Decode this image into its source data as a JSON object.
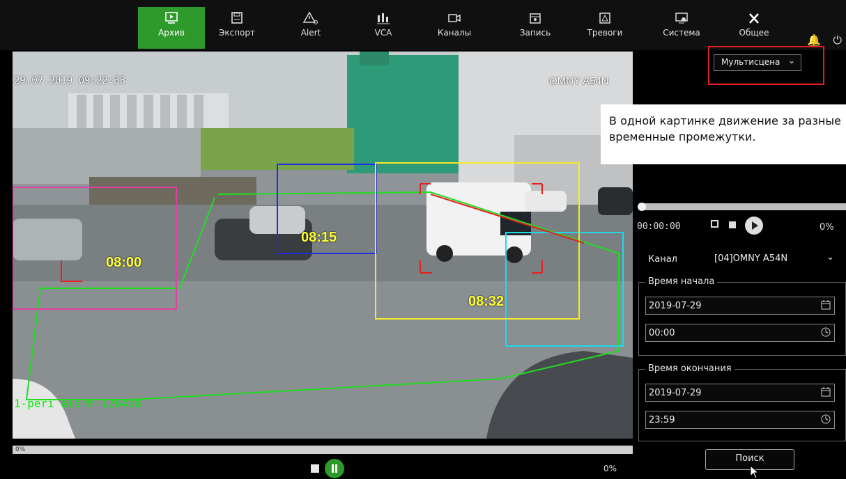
{
  "nav": {
    "items": [
      {
        "label": "Архив",
        "icon": "archive-icon",
        "active": true
      },
      {
        "label": "Экспорт",
        "icon": "save-icon"
      },
      {
        "label": "Alert",
        "icon": "alert-icon"
      },
      {
        "label": "VCA",
        "icon": "vca-icon"
      },
      {
        "label": "Каналы",
        "icon": "camera-icon"
      },
      {
        "label": "Запись",
        "icon": "record-icon"
      },
      {
        "label": "Тревоги",
        "icon": "alarm-icon"
      },
      {
        "label": "Система",
        "icon": "system-icon"
      },
      {
        "label": "Общее",
        "icon": "tools-icon"
      }
    ],
    "accent": "#2e9a2b"
  },
  "video": {
    "timestamp": "29.07.2019 09:22:33",
    "camera_name": "OMNY A54N",
    "labels": [
      "08:00",
      "08:15",
      "08:32"
    ],
    "alarm_text": "1-peri alarm-126408",
    "progress_text": "0%"
  },
  "playback": {
    "percent": "0%"
  },
  "right": {
    "mode_select": "Мультисцена",
    "annotation": "В одной картинке движение за разные временные промежутки.",
    "mini_time": "00:00:00",
    "mini_percent": "0%",
    "channel_label": "Канал",
    "channel_value": "[04]OMNY A54N",
    "start_title": "Время начала",
    "start_date": "2019-07-29",
    "start_time": "00:00",
    "end_title": "Время окончания",
    "end_date": "2019-07-29",
    "end_time": "23:59",
    "search_label": "Поиск"
  }
}
